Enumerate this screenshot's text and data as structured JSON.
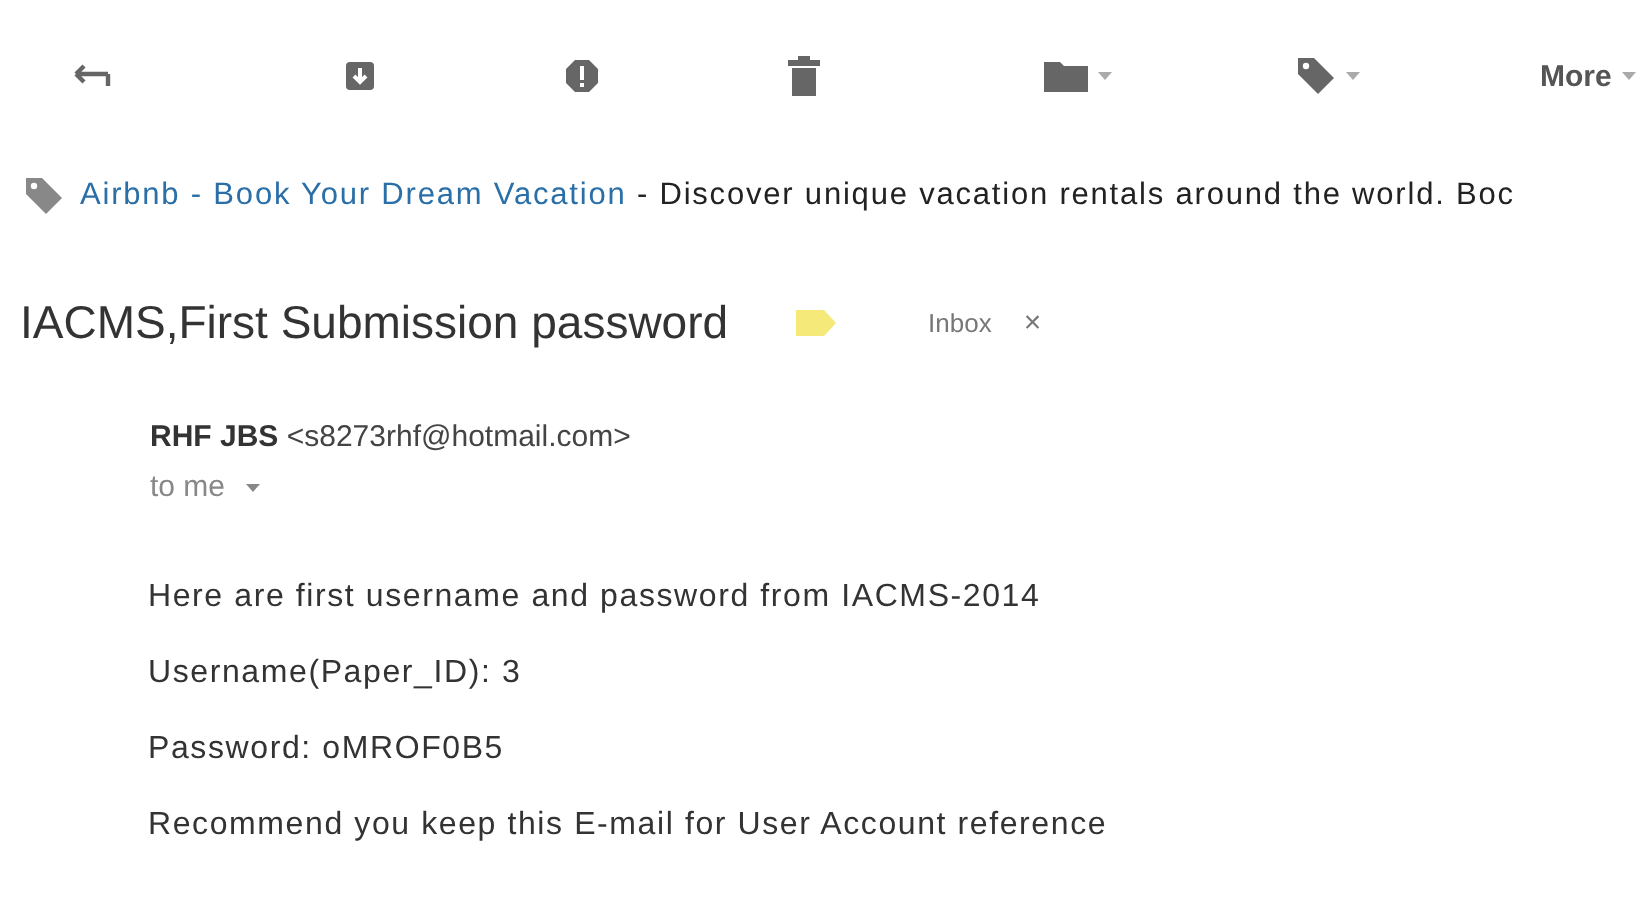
{
  "toolbar": [
    {
      "kind": "reply"
    },
    {
      "kind": "archive"
    },
    {
      "kind": "spam"
    },
    {
      "kind": "delete"
    },
    {
      "kind": "move",
      "menu": true
    },
    {
      "kind": "labels",
      "menu": true
    },
    {
      "kind": "more",
      "label": "More",
      "menu": true
    }
  ],
  "ad": {
    "link": "Airbnb - Book Your Dream Vacation",
    "text": " - Discover unique vacation rentals around the world. Boc"
  },
  "subject": "IACMS,First Submission password",
  "important": true,
  "labels": [
    {
      "name": "Inbox",
      "remove": "×"
    }
  ],
  "sender": {
    "name": "RHF JBS",
    "email": "<s8273rhf@hotmail.com>",
    "to": "to me"
  },
  "body": [
    "Here are first username and password from IACMS-2014",
    "Username(Paper_ID): 3",
    "Password: oMROF0B5",
    "Recommend you keep this E-mail for User Account reference"
  ]
}
